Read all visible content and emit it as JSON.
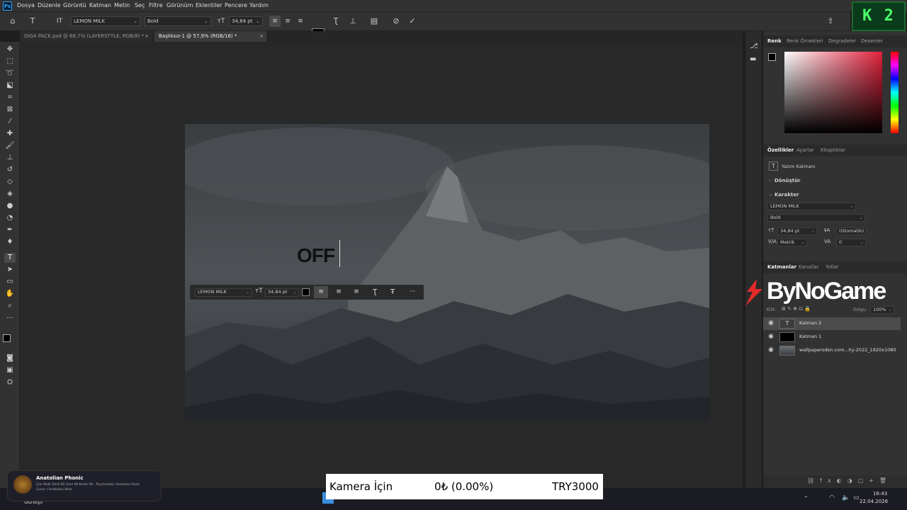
{
  "app": {
    "logo": "Ps"
  },
  "menu": [
    "Dosya",
    "Düzenle",
    "Görüntü",
    "Katman",
    "Metin",
    "Seç",
    "Filtre",
    "Görünüm",
    "Eklentiler",
    "Pencere",
    "Yardım"
  ],
  "options": {
    "font_family": "LEMON MILK",
    "font_style": "Bold",
    "font_size": "34,84 pt",
    "text_color": "#000000"
  },
  "badge": {
    "text": "K 2"
  },
  "tabs": [
    {
      "label": "GIGA PACK.psd @ 66,7% (LAYERSTYLE, RGB/8) *",
      "active": false
    },
    {
      "label": "Başlıksız-1 @ 57,9% (RGB/16) *",
      "active": true
    }
  ],
  "canvas": {
    "text": "OFF"
  },
  "floating_bar": {
    "font": "LEMON MILK",
    "size": "34,84 pt",
    "more": "···"
  },
  "color_panel": {
    "tabs": [
      "Renk",
      "Renk Örnekleri",
      "Degradeler",
      "Desenler"
    ]
  },
  "properties": {
    "tabs": [
      "Özellikler",
      "Ayarlar",
      "Kitaplıklar"
    ],
    "layer_type": "Yazım Katmanı",
    "transform": "Dönüştür",
    "character": "Karakter",
    "font_family": "LEMON MILK",
    "font_style": "Bold",
    "size": "34,84 pt",
    "leading": "(Otomatik)",
    "kerning": "Metrik",
    "tracking": "0"
  },
  "layers_panel": {
    "tabs": [
      "Katmanlar",
      "Kanallar",
      "Yollar"
    ],
    "lock_label": "Kilit:",
    "fill_label": "Dolgu:",
    "fill_value": "100%",
    "layers": [
      {
        "name": "Katman 2",
        "type": "text",
        "selected": true
      },
      {
        "name": "Katman 1",
        "type": "fill",
        "selected": false
      },
      {
        "name": "wallpapersden.com...hy-2022_1920x1080",
        "type": "image",
        "selected": false
      }
    ]
  },
  "overlay_logo": {
    "text": "ByNoGame"
  },
  "music": {
    "title": "Anatolian Phonic",
    "line1": "Çile Mi̇dir Derti̇ Bi̇l Gam Mı Keder Mi - Psychedelic Anatolian Rock",
    "line2": "Cover | Anatolian Wise"
  },
  "weather_label": "Güneşli",
  "donation": {
    "label": "Kamera İçin",
    "amount": "0₺ (0.00%)",
    "goal": "TRY3000"
  },
  "clock": {
    "time": "16:43",
    "date": "22.04.2026"
  }
}
